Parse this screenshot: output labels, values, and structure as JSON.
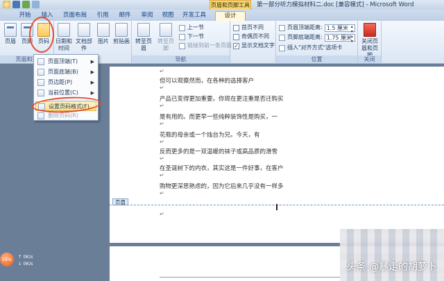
{
  "titlebar": {
    "contextual_tab_group": "页眉和页脚工具",
    "title": "第一部分听力模拟材料二.doc [兼容模式] - Microsoft Word"
  },
  "tabs": [
    "开始",
    "插入",
    "页面布局",
    "引用",
    "邮件",
    "审阅",
    "视图",
    "开发工具",
    "设计"
  ],
  "ribbon": {
    "header_footer_group": {
      "label": "页眉和页",
      "header": "页眉",
      "footer": "页脚",
      "page_number": "页码"
    },
    "insert_group": {
      "date_time": "日期和时间",
      "doc_parts": "文档部件",
      "picture": "图片",
      "clip_art": "剪贴画"
    },
    "nav_group": {
      "label": "导航",
      "goto_header": "转至页眉",
      "goto_footer": "转至页脚",
      "prev_section": "上一节",
      "next_section": "下一节",
      "link_prev": "链接到前一条页眉"
    },
    "options_group": {
      "first_page": "首页不同",
      "odd_even": "奇偶页不同",
      "show_text": "显示文档文字"
    },
    "position_group": {
      "label": "位置",
      "header_top": "页眉顶端距离:",
      "header_top_value": "1.5 厘米",
      "footer_bottom": "页脚底端距离:",
      "footer_bottom_value": "1.75 厘米",
      "insert_align_tab": "插入\"对齐方式\"选项卡"
    },
    "close_group": {
      "label": "关闭",
      "close": "关闭页眉和页脚"
    }
  },
  "dropdown": {
    "items": [
      {
        "label": "页面顶端(T)",
        "has_submenu": true
      },
      {
        "label": "页面底端(B)",
        "has_submenu": true
      },
      {
        "label": "页边距(P)",
        "has_submenu": true
      },
      {
        "label": "当前位置(C)",
        "has_submenu": true
      },
      {
        "label": "设置页码格式(F)...",
        "has_submenu": false
      },
      {
        "label": "删除页码(R)",
        "has_submenu": false
      }
    ]
  },
  "document": {
    "lines": [
      "但可以观察然而，在各种的选择客户",
      "产品已变得更加重要。你现在更注重是否迁购买",
      "是有用的。而更早一些纯粹装饰性是购买，一",
      "花瓶的母亲或一个烛台为兄。今天，有",
      "反而更多的是一双温暖的袜子或高品质的滑雪",
      "在圣诞树下的内衣，其实这是一件好事，在客户",
      "购物更深思熟虑的，因为它后来几乎没有一样多"
    ],
    "header_tag": "页眉"
  },
  "network": {
    "percent": "55%",
    "up": "0K/s",
    "down": "0K/s"
  },
  "watermark": "头条 @暴走的胡萝卜"
}
